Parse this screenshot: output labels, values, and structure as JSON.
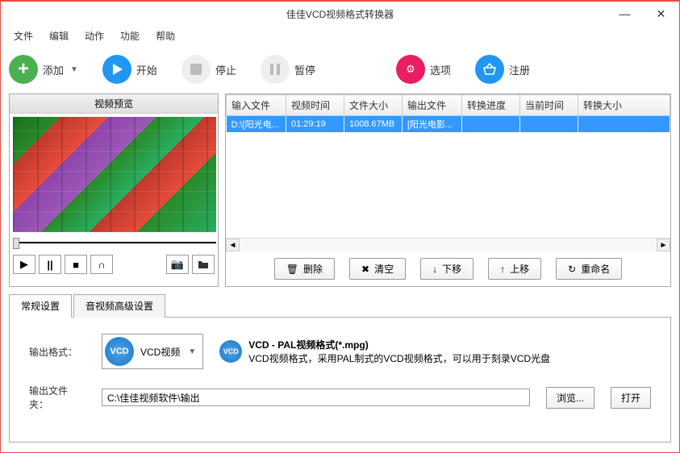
{
  "window": {
    "title": "佳佳VCD视频格式转换器"
  },
  "menu": {
    "file": "文件",
    "edit": "编辑",
    "action": "动作",
    "function": "功能",
    "help": "帮助"
  },
  "toolbar": {
    "add": "添加",
    "start": "开始",
    "stop": "停止",
    "pause": "暂停",
    "options": "选项",
    "register": "注册"
  },
  "preview": {
    "title": "视频预览"
  },
  "table": {
    "headers": {
      "input": "输入文件",
      "duration": "视频时间",
      "size": "文件大小",
      "output": "输出文件",
      "progress": "转换进度",
      "current": "当前时间",
      "outsize": "转换大小"
    },
    "row": {
      "input": "D:\\[阳光电...",
      "duration": "01:29:19",
      "size": "1008.67MB",
      "output": "[阳光电影...",
      "progress": "",
      "current": "",
      "outsize": ""
    }
  },
  "actions": {
    "delete": "删除",
    "clear": "清空",
    "down": "下移",
    "up": "上移",
    "rename": "重命名"
  },
  "tabs": {
    "general": "常规设置",
    "advanced": "音视频高级设置"
  },
  "settings": {
    "format_label": "输出格式：",
    "format_name": "VCD视频",
    "format_title": "VCD - PAL视频格式(*.mpg)",
    "format_desc": "VCD视频格式，采用PAL制式的VCD视频格式，可以用于刻录VCD光盘",
    "folder_label": "输出文件夹：",
    "folder_path": "C:\\佳佳视频软件\\输出",
    "browse": "浏览...",
    "open": "打开"
  }
}
